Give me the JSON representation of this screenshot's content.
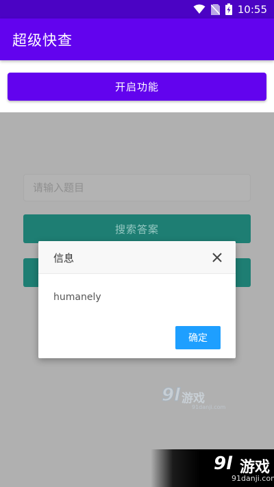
{
  "status_bar": {
    "time": "10:55",
    "bg_color": "#4b03c4"
  },
  "app_bar": {
    "title": "超级快查",
    "bg_color": "#6203ee"
  },
  "enable_button": {
    "label": "开启功能"
  },
  "web": {
    "question_placeholder": "请输入题目",
    "search_button_label": "搜索答案",
    "button_color": "#1e7e73"
  },
  "dialog": {
    "title": "信息",
    "message": "humanely",
    "ok_label": "确定",
    "ok_color": "#1e9fff"
  },
  "watermark": {
    "logo_number": "9l",
    "logo_text": "游戏",
    "logo_url_small": "91danji.com",
    "logo_url": "91danji.com"
  },
  "icons": [
    "wifi-icon",
    "no-sim-icon",
    "battery-charging-icon",
    "close-icon"
  ]
}
